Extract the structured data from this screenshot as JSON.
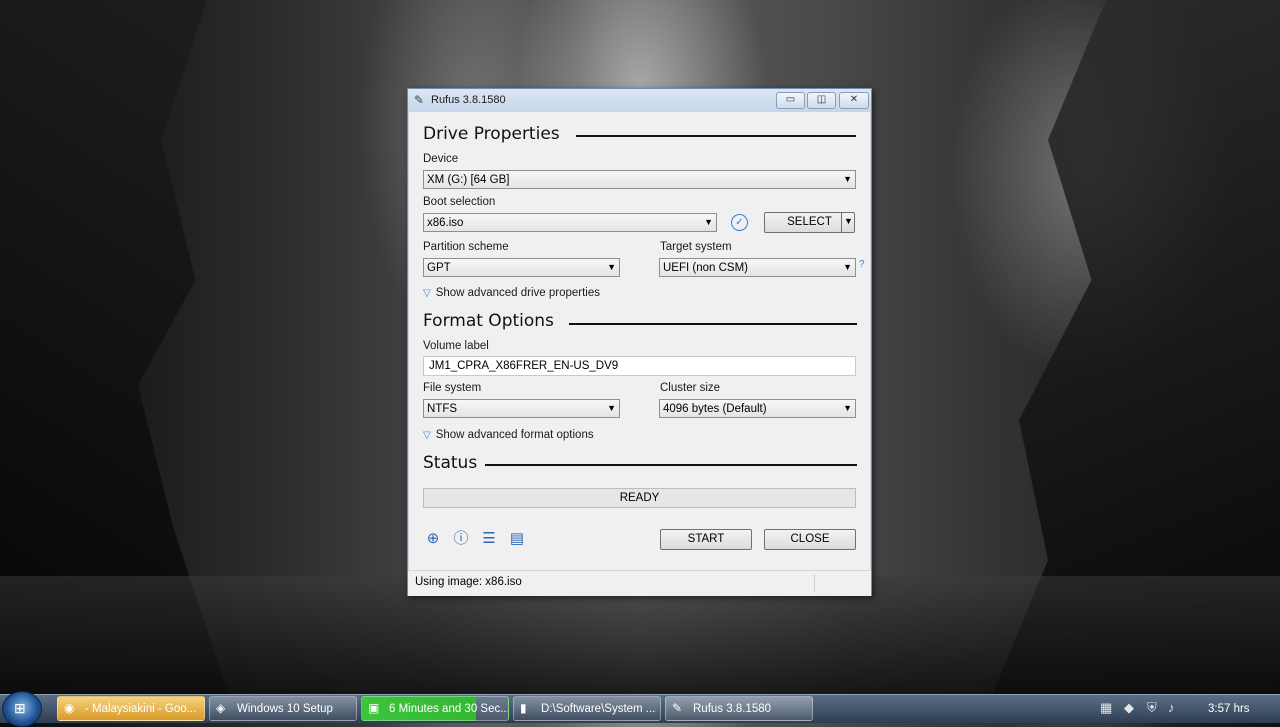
{
  "window": {
    "title": "Rufus 3.8.1580",
    "controls": {
      "minimize": "▭",
      "maximize": "◫",
      "close": "✕"
    }
  },
  "drive_properties": {
    "heading": "Drive Properties",
    "device_label": "Device",
    "device_value": "XM (G:) [64 GB]",
    "boot_selection_label": "Boot selection",
    "boot_selection_value": "x86.iso",
    "select_button": "SELECT",
    "partition_scheme_label": "Partition scheme",
    "partition_scheme_value": "GPT",
    "target_system_label": "Target system",
    "target_system_value": "UEFI (non CSM)",
    "help_mark": "?",
    "advanced_link": "Show advanced drive properties"
  },
  "format_options": {
    "heading": "Format Options",
    "volume_label_label": "Volume label",
    "volume_label_value": "JM1_CPRA_X86FRER_EN-US_DV9",
    "file_system_label": "File system",
    "file_system_value": "NTFS",
    "cluster_size_label": "Cluster size",
    "cluster_size_value": "4096 bytes (Default)",
    "advanced_link": "Show advanced format options"
  },
  "status": {
    "heading": "Status",
    "progress_text": "READY",
    "progress_fraction": 0
  },
  "actions": {
    "start": "START",
    "close": "CLOSE"
  },
  "toolbar_icons": [
    "globe-icon",
    "info-icon",
    "settings-sliders-icon",
    "log-icon"
  ],
  "statusbar": {
    "text": "Using image: x86.iso"
  },
  "taskbar": {
    "items": [
      {
        "label": "- Malaysiakini - Goo...",
        "icon": "chrome-icon"
      },
      {
        "label": "Windows 10 Setup",
        "icon": "setup-icon"
      },
      {
        "label": "6 Minutes and 30 Sec...",
        "icon": "copy-progress-icon"
      },
      {
        "label": "D:\\Software\\System ...",
        "icon": "folder-icon"
      },
      {
        "label": "Rufus 3.8.1580",
        "icon": "rufus-icon"
      }
    ],
    "clock": "3:57 hrs"
  }
}
